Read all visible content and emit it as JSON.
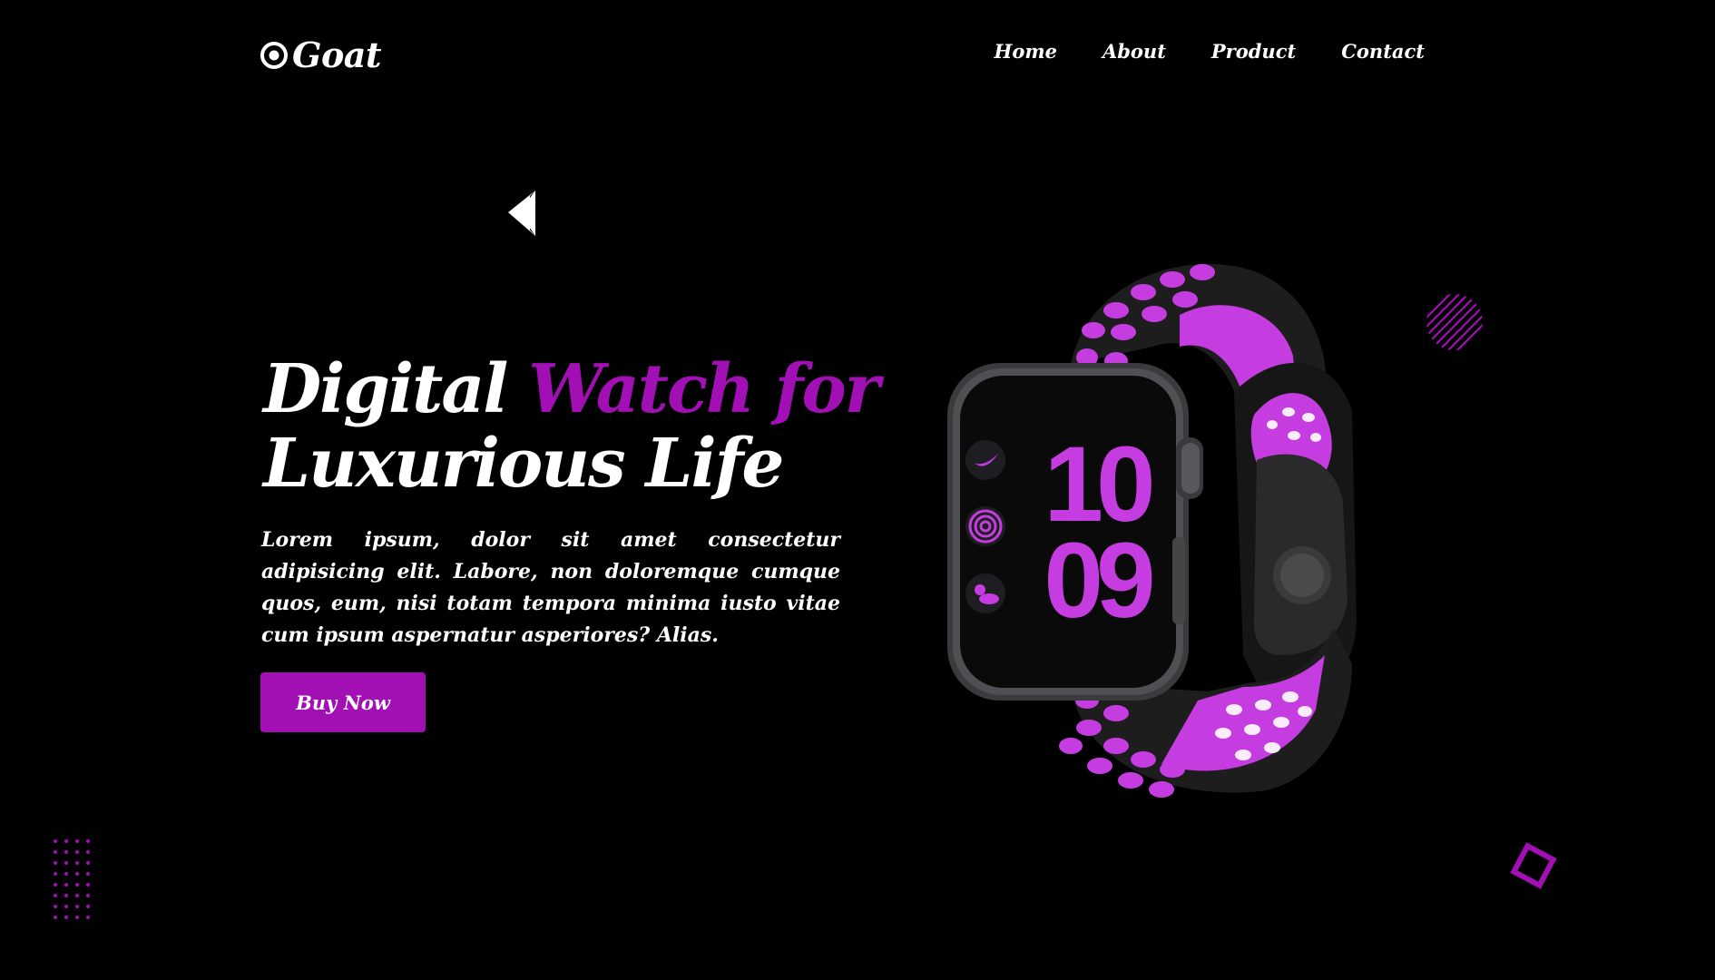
{
  "brand": {
    "name": "Goat",
    "accent_color": "#a10fb5"
  },
  "nav": {
    "items": [
      {
        "label": "Home"
      },
      {
        "label": "About"
      },
      {
        "label": "Product"
      },
      {
        "label": "Contact"
      }
    ]
  },
  "hero": {
    "title_part1": "Digital",
    "title_part2": "Watch for",
    "title_part3": "Luxurious Life",
    "description": "Lorem ipsum, dolor sit amet consectetur adipisicing elit. Labore, non doloremque cumque quos, eum, nisi totam tempora minima iusto vitae cum ipsum aspernatur asperiores? Alias.",
    "cta_label": "Buy Now"
  },
  "product_image": {
    "subject": "smartwatch",
    "screen_hours": "10",
    "screen_minutes": "09",
    "band_colors": [
      "#1a1a1a",
      "#c53de0"
    ]
  },
  "icons": [
    "logo-target-icon",
    "triangle-arrow-icon",
    "hatched-circle-icon",
    "dot-grid-icon",
    "diamond-outline-icon"
  ]
}
